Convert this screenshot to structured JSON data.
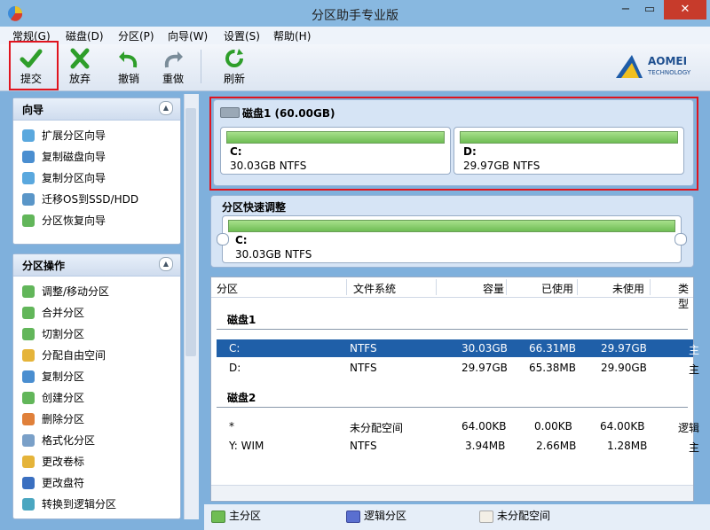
{
  "app_title": "分区助手专业版",
  "window_controls": {
    "minimize": "−",
    "maximize": "▭",
    "close": "✕"
  },
  "menu": [
    "常规(G)",
    "磁盘(D)",
    "分区(P)",
    "向导(W)",
    "设置(S)",
    "帮助(H)"
  ],
  "toolbar": {
    "submit": "提交",
    "discard": "放弃",
    "undo": "撤销",
    "redo": "重做",
    "refresh": "刷新"
  },
  "logo": {
    "name": "AOMEI",
    "sub": "TECHNOLOGY"
  },
  "wizard_panel": {
    "title": "向导",
    "items": [
      "扩展分区向导",
      "复制磁盘向导",
      "复制分区向导",
      "迁移OS到SSD/HDD",
      "分区恢复向导"
    ]
  },
  "partition_ops_panel": {
    "title": "分区操作",
    "items": [
      "调整/移动分区",
      "合并分区",
      "切割分区",
      "分配自由空间",
      "复制分区",
      "创建分区",
      "删除分区",
      "格式化分区",
      "更改卷标",
      "更改盘符",
      "转换到逻辑分区"
    ]
  },
  "disk_map": {
    "title": "磁盘1 (60.00GB)",
    "partitions": [
      {
        "name": "C:",
        "info": "30.03GB NTFS"
      },
      {
        "name": "D:",
        "info": "29.97GB NTFS"
      }
    ]
  },
  "quick_adjust": {
    "title": "分区快速调整",
    "name": "C:",
    "info": "30.03GB NTFS"
  },
  "table": {
    "headers": [
      "分区",
      "文件系统",
      "容量",
      "已使用",
      "未使用",
      "类型"
    ],
    "groups": [
      {
        "disk": "磁盘1",
        "rows": [
          {
            "part": "C:",
            "fs": "NTFS",
            "cap": "30.03GB",
            "used": "66.31MB",
            "free": "29.97GB",
            "type": "主"
          },
          {
            "part": "D:",
            "fs": "NTFS",
            "cap": "29.97GB",
            "used": "65.38MB",
            "free": "29.90GB",
            "type": "主"
          }
        ]
      },
      {
        "disk": "磁盘2",
        "rows": [
          {
            "part": "*",
            "fs": "未分配空间",
            "cap": "64.00KB",
            "used": "0.00KB",
            "free": "64.00KB",
            "type": "逻辑"
          },
          {
            "part": "Y: WIM",
            "fs": "NTFS",
            "cap": "3.94MB",
            "used": "2.66MB",
            "free": "1.28MB",
            "type": "主"
          }
        ]
      }
    ]
  },
  "legend": [
    "主分区",
    "逻辑分区",
    "未分配空间"
  ],
  "colors": {
    "primary": "#6fbd54",
    "logical": "#5a6fd0",
    "unallocated": "#f3efe6",
    "highlight": "#e0141e",
    "selected_row": "#1f5fa8"
  }
}
